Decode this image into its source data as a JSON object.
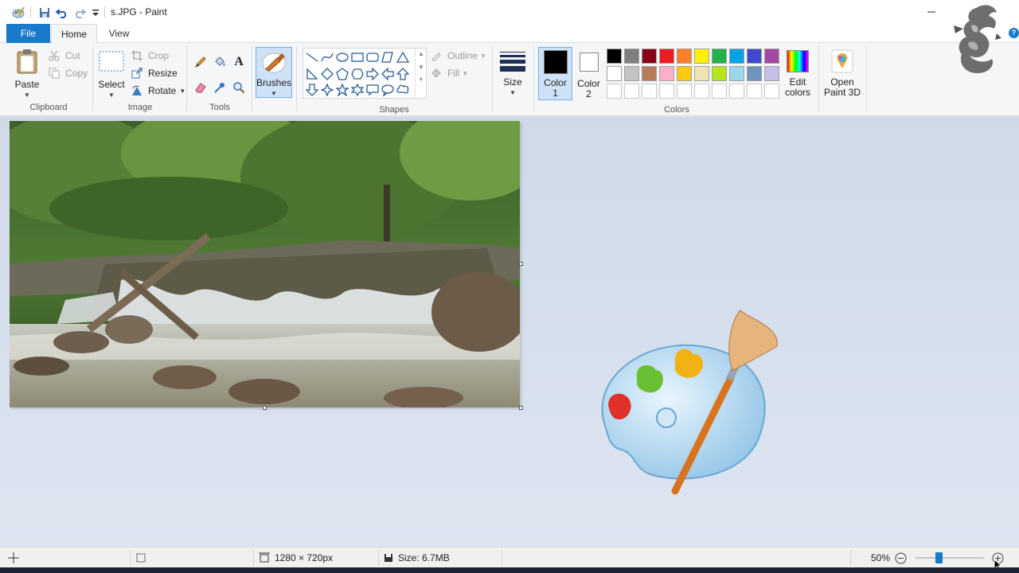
{
  "window": {
    "title": "s.JPG - Paint"
  },
  "quick_access": [
    "paint-app-icon",
    "save-icon",
    "undo-icon",
    "redo-icon",
    "customize-dropdown-icon"
  ],
  "tabs": {
    "file": "File",
    "home": "Home",
    "view": "View"
  },
  "help": "?",
  "clipboard": {
    "paste": "Paste",
    "cut": "Cut",
    "copy": "Copy",
    "label": "Clipboard"
  },
  "image": {
    "select": "Select",
    "crop": "Crop",
    "resize": "Resize",
    "rotate": "Rotate",
    "label": "Image"
  },
  "tools": {
    "label": "Tools",
    "text_glyph": "A"
  },
  "brushes": {
    "label": "Brushes"
  },
  "shapes": {
    "outline": "Outline",
    "fill": "Fill",
    "label": "Shapes"
  },
  "size": {
    "label": "Size"
  },
  "colors": {
    "color1_label": "Color",
    "color1_num": "1",
    "color2_label": "Color",
    "color2_num": "2",
    "color1": "#000000",
    "color2": "#ffffff",
    "label": "Colors",
    "edit_line1": "Edit",
    "edit_line2": "colors",
    "palette_row1": [
      "#000000",
      "#7f7f7f",
      "#880015",
      "#ed1c24",
      "#ff7f27",
      "#fff200",
      "#22b14c",
      "#00a2e8",
      "#3f48cc",
      "#a349a4"
    ],
    "palette_row2": [
      "#ffffff",
      "#c3c3c3",
      "#b97a57",
      "#ffaec9",
      "#ffc90e",
      "#efe4b0",
      "#b5e61d",
      "#99d9ea",
      "#7092be",
      "#c8bfe7"
    ]
  },
  "paint3d": {
    "line1": "Open",
    "line2": "Paint 3D"
  },
  "status": {
    "dimensions": "1280 × 720px",
    "size": "Size: 6.7MB",
    "zoom": "50%",
    "zoom_level": 0.5
  }
}
